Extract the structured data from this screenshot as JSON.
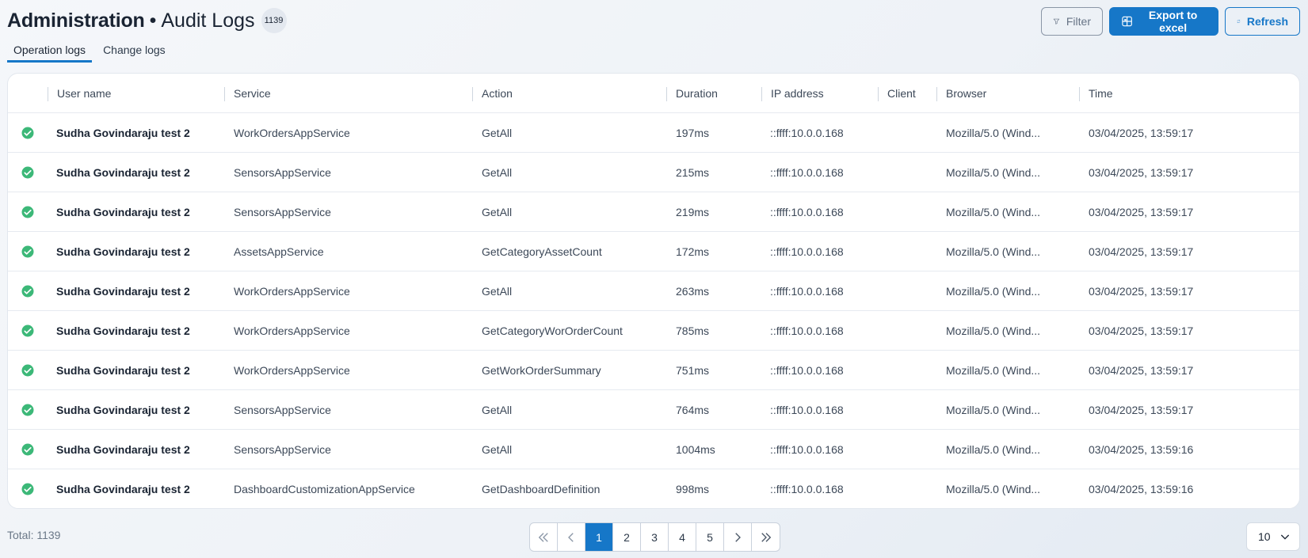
{
  "header": {
    "title": "Administration",
    "separator": "•",
    "subtitle": "Audit Logs",
    "count_badge": "1139"
  },
  "actions": {
    "filter_label": "Filter",
    "export_label": "Export to excel",
    "refresh_label": "Refresh"
  },
  "tabs": [
    {
      "label": "Operation logs",
      "active": true
    },
    {
      "label": "Change logs",
      "active": false
    }
  ],
  "columns": [
    "User name",
    "Service",
    "Action",
    "Duration",
    "IP address",
    "Client",
    "Browser",
    "Time"
  ],
  "rows": [
    {
      "status": "success",
      "user": "Sudha Govindaraju test 2",
      "service": "WorkOrdersAppService",
      "action": "GetAll",
      "duration": "197ms",
      "ip": "::ffff:10.0.0.168",
      "client": "",
      "browser": "Mozilla/5.0 (Wind...",
      "time": "03/04/2025, 13:59:17"
    },
    {
      "status": "success",
      "user": "Sudha Govindaraju test 2",
      "service": "SensorsAppService",
      "action": "GetAll",
      "duration": "215ms",
      "ip": "::ffff:10.0.0.168",
      "client": "",
      "browser": "Mozilla/5.0 (Wind...",
      "time": "03/04/2025, 13:59:17"
    },
    {
      "status": "success",
      "user": "Sudha Govindaraju test 2",
      "service": "SensorsAppService",
      "action": "GetAll",
      "duration": "219ms",
      "ip": "::ffff:10.0.0.168",
      "client": "",
      "browser": "Mozilla/5.0 (Wind...",
      "time": "03/04/2025, 13:59:17"
    },
    {
      "status": "success",
      "user": "Sudha Govindaraju test 2",
      "service": "AssetsAppService",
      "action": "GetCategoryAssetCount",
      "duration": "172ms",
      "ip": "::ffff:10.0.0.168",
      "client": "",
      "browser": "Mozilla/5.0 (Wind...",
      "time": "03/04/2025, 13:59:17"
    },
    {
      "status": "success",
      "user": "Sudha Govindaraju test 2",
      "service": "WorkOrdersAppService",
      "action": "GetAll",
      "duration": "263ms",
      "ip": "::ffff:10.0.0.168",
      "client": "",
      "browser": "Mozilla/5.0 (Wind...",
      "time": "03/04/2025, 13:59:17"
    },
    {
      "status": "success",
      "user": "Sudha Govindaraju test 2",
      "service": "WorkOrdersAppService",
      "action": "GetCategoryWorOrderCount",
      "duration": "785ms",
      "ip": "::ffff:10.0.0.168",
      "client": "",
      "browser": "Mozilla/5.0 (Wind...",
      "time": "03/04/2025, 13:59:17"
    },
    {
      "status": "success",
      "user": "Sudha Govindaraju test 2",
      "service": "WorkOrdersAppService",
      "action": "GetWorkOrderSummary",
      "duration": "751ms",
      "ip": "::ffff:10.0.0.168",
      "client": "",
      "browser": "Mozilla/5.0 (Wind...",
      "time": "03/04/2025, 13:59:17"
    },
    {
      "status": "success",
      "user": "Sudha Govindaraju test 2",
      "service": "SensorsAppService",
      "action": "GetAll",
      "duration": "764ms",
      "ip": "::ffff:10.0.0.168",
      "client": "",
      "browser": "Mozilla/5.0 (Wind...",
      "time": "03/04/2025, 13:59:17"
    },
    {
      "status": "success",
      "user": "Sudha Govindaraju test 2",
      "service": "SensorsAppService",
      "action": "GetAll",
      "duration": "1004ms",
      "ip": "::ffff:10.0.0.168",
      "client": "",
      "browser": "Mozilla/5.0 (Wind...",
      "time": "03/04/2025, 13:59:16"
    },
    {
      "status": "success",
      "user": "Sudha Govindaraju test 2",
      "service": "DashboardCustomizationAppService",
      "action": "GetDashboardDefinition",
      "duration": "998ms",
      "ip": "::ffff:10.0.0.168",
      "client": "",
      "browser": "Mozilla/5.0 (Wind...",
      "time": "03/04/2025, 13:59:16"
    }
  ],
  "footer": {
    "total_label": "Total: 1139",
    "pages": [
      "1",
      "2",
      "3",
      "4",
      "5"
    ],
    "current_page": "1",
    "page_size": "10"
  },
  "colors": {
    "accent": "#1677c8",
    "success": "#3cb878"
  },
  "icons": {
    "filter": "filter-icon",
    "export": "excel-icon",
    "refresh": "refresh-icon",
    "status": "check-circle-icon",
    "first": "double-chevron-left-icon",
    "prev": "chevron-left-icon",
    "next": "chevron-right-icon",
    "last": "double-chevron-right-icon",
    "dropdown": "chevron-down-icon"
  }
}
